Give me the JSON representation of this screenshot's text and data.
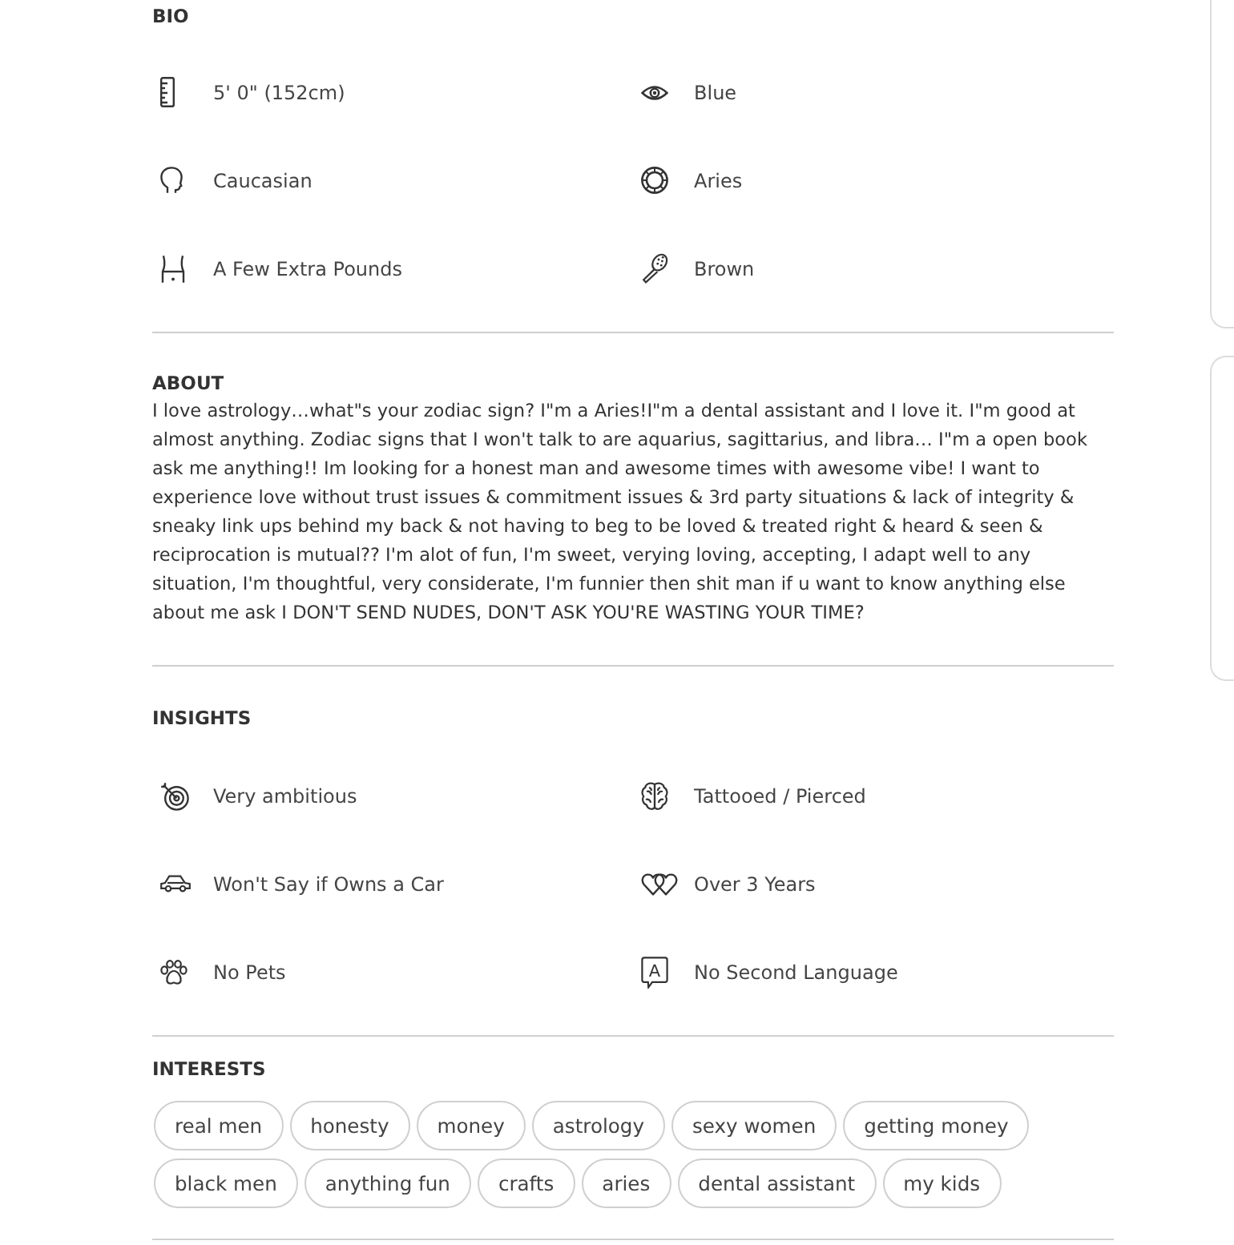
{
  "bio": {
    "title": "BIO",
    "items": [
      {
        "label": "5' 0\" (152cm)"
      },
      {
        "label": "Blue"
      },
      {
        "label": "Caucasian"
      },
      {
        "label": "Aries"
      },
      {
        "label": "A Few Extra Pounds"
      },
      {
        "label": "Brown"
      }
    ]
  },
  "about": {
    "title": "ABOUT",
    "text": "I love astrology…what\"s your zodiac sign? I\"m a Aries!I\"m a dental assistant and I love it. I\"m good at almost anything. Zodiac signs that I won't talk to are aquarius, sagittarius, and libra… I\"m a open book ask me anything!! Im looking for a honest man and awesome times with awesome vibe! I want to experience love without trust issues & commitment issues & 3rd party situations & lack of integrity & sneaky link ups behind my back & not having to beg to be loved & treated right & heard & seen & reciprocation is mutual?? I'm alot of fun, I'm sweet, verying loving, accepting, I adapt well to any situation, I'm thoughtful, very considerate, I'm funnier then shit man if u want to know anything else about me ask I DON'T SEND NUDES, DON'T ASK YOU'RE WASTING YOUR TIME?"
  },
  "insights": {
    "title": "INSIGHTS",
    "items": [
      {
        "label": "Very ambitious"
      },
      {
        "label": "Tattooed / Pierced"
      },
      {
        "label": "Won't Say if Owns a Car"
      },
      {
        "label": "Over 3 Years"
      },
      {
        "label": "No Pets"
      },
      {
        "label": "No Second Language",
        "icon_letter": "A"
      }
    ]
  },
  "interests": {
    "title": "INTERESTS",
    "tags": [
      "real men",
      "honesty",
      "money",
      "astrology",
      "sexy women",
      "getting money",
      "black men",
      "anything fun",
      "crafts",
      "aries",
      "dental assistant",
      "my kids"
    ]
  }
}
